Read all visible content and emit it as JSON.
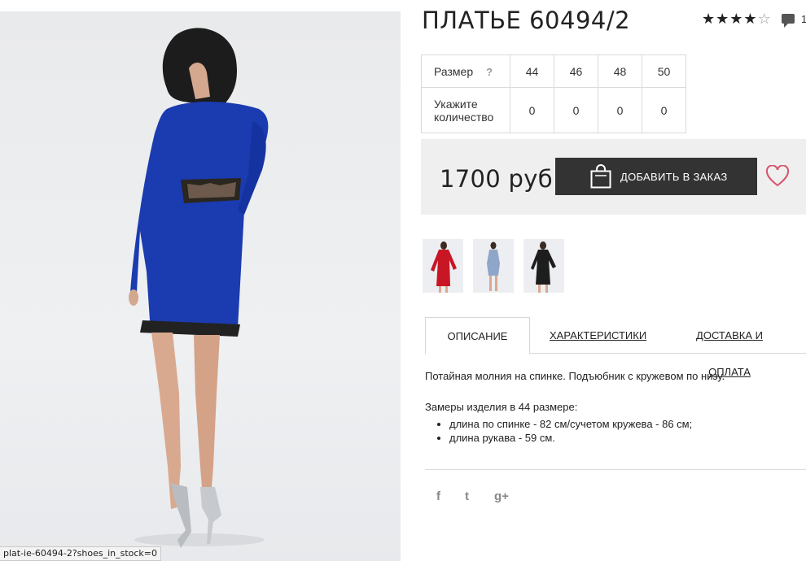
{
  "product": {
    "title": "ПЛАТЬЕ 60494/2",
    "rating": 4,
    "rating_max": 5,
    "comment_count": "1"
  },
  "status_url": "plat-ie-60494-2?shoes_in_stock=0",
  "sizes": {
    "size_label": "Размер",
    "help_mark": "?",
    "qty_label_line1": "Укажите",
    "qty_label_line2": "количество",
    "columns": [
      {
        "size": "44",
        "qty": "0"
      },
      {
        "size": "46",
        "qty": "0"
      },
      {
        "size": "48",
        "qty": "0"
      },
      {
        "size": "50",
        "qty": "0"
      }
    ]
  },
  "price": "1700 руб",
  "order_button": "ДОБАВИТЬ В ЗАКАЗ",
  "thumbnails": [
    {
      "name": "thumb-red",
      "color": "#c81624"
    },
    {
      "name": "thumb-blue",
      "color": "#8fa6c8"
    },
    {
      "name": "thumb-black",
      "color": "#1d1d1d"
    }
  ],
  "tabs": [
    {
      "label": "ОПИСАНИЕ",
      "active": true
    },
    {
      "label": "ХАРАКТЕРИСТИКИ",
      "active": false
    },
    {
      "label": "ДОСТАВКА И ОПЛАТА",
      "active": false
    }
  ],
  "description": {
    "intro": "Потайная молния на спинке. Подъюбник с кружевом по низу.",
    "measure_title": "Замеры изделия в 44 размере:",
    "items": [
      "длина по спинке - 82 см/сучетом кружева - 86 см;",
      "длина рукава - 59 см."
    ]
  },
  "social": {
    "facebook": "f",
    "twitter": "t",
    "google": "g+"
  },
  "colors": {
    "dress": "#1b3bb0",
    "button": "#333333",
    "heart": "#d9536a"
  }
}
